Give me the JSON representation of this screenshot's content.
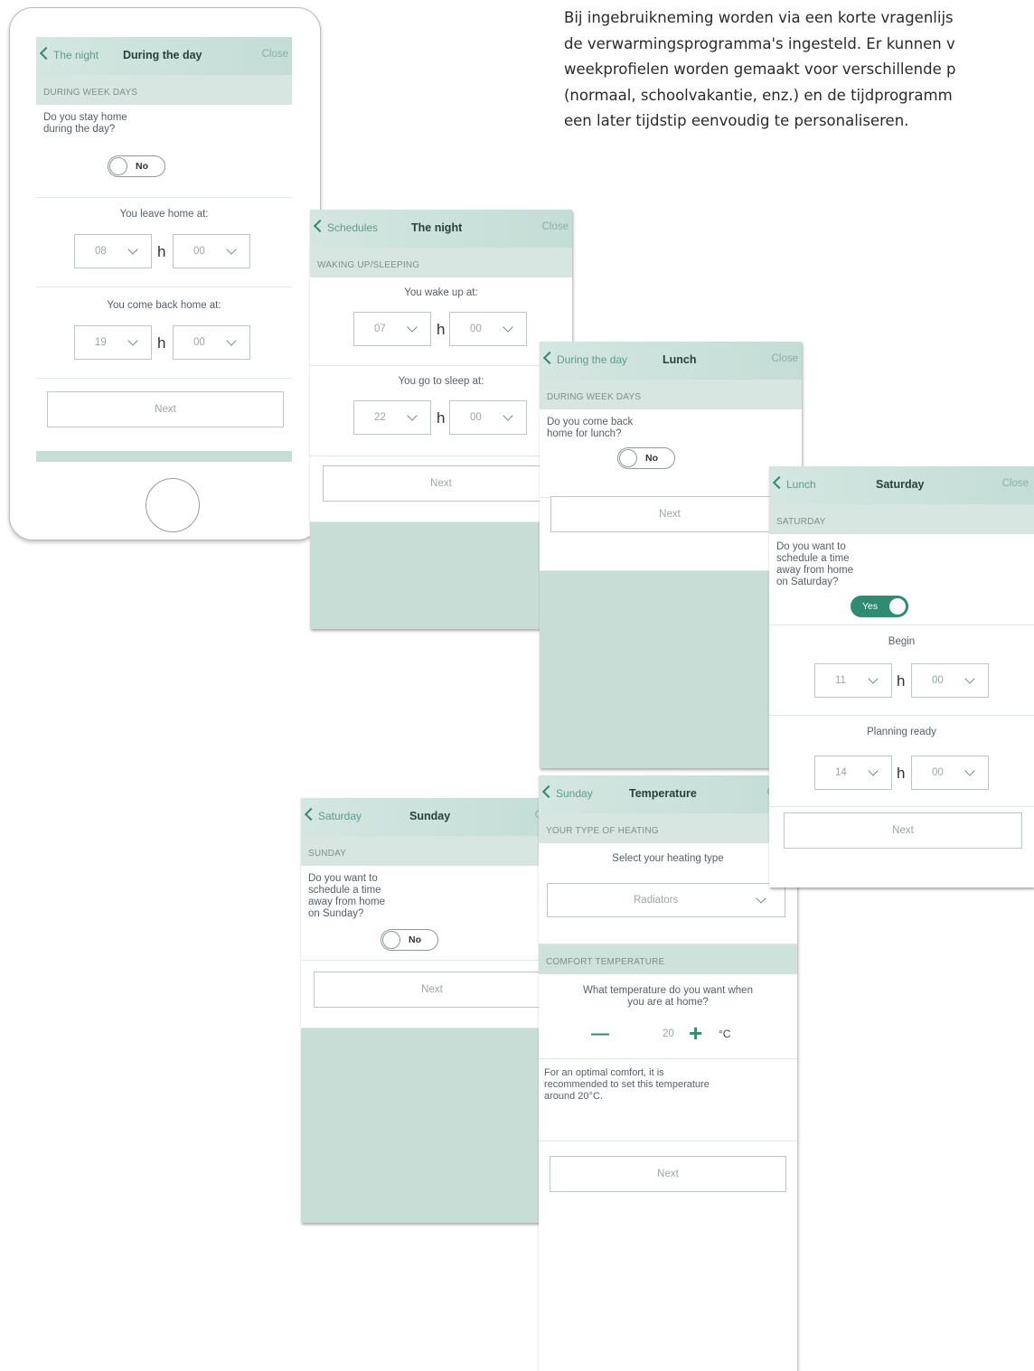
{
  "intro_lines": [
    "Bij ingebruikneming worden via een korte vragenlijs",
    "de verwarmingsprogramma's ingesteld. Er kunnen v",
    "weekprofielen worden gemaakt voor verschillende p",
    "(normaal, schoolvakantie, enz.) en de tijdprogramm",
    "een later tijdstip eenvoudig te personaliseren."
  ],
  "close_label": "Close",
  "next_label": "Next",
  "h_label": "h",
  "day": {
    "back": "The night",
    "title": "During the day",
    "section": "DURING WEEK DAYS",
    "question": [
      "Do you stay home",
      "during the day?"
    ],
    "toggle": "No",
    "leave_label": "You leave home at:",
    "leave_hour": "08",
    "leave_min": "00",
    "return_label": "You come back home at:",
    "return_hour": "19",
    "return_min": "00"
  },
  "night": {
    "back": "Schedules",
    "title": "The night",
    "section": "WAKING UP/SLEEPING",
    "wake_label": "You wake up at:",
    "wake_hour": "07",
    "wake_min": "00",
    "sleep_label": "You go to sleep at:",
    "sleep_hour": "22",
    "sleep_min": "00"
  },
  "lunch": {
    "back": "During the day",
    "title": "Lunch",
    "section": "DURING WEEK DAYS",
    "question": [
      "Do you come back",
      "home for lunch?"
    ],
    "toggle": "No"
  },
  "saturday": {
    "back": "Lunch",
    "title": "Saturday",
    "section": "SATURDAY",
    "question": [
      "Do you want to",
      "schedule a time",
      "away from home",
      "on Saturday?"
    ],
    "toggle": "Yes",
    "begin_label": "Begin",
    "begin_hour": "11",
    "begin_min": "00",
    "ready_label": "Planning ready",
    "ready_hour": "14",
    "ready_min": "00"
  },
  "sunday": {
    "back": "Saturday",
    "title": "Sunday",
    "section": "SUNDAY",
    "question": [
      "Do you want to",
      "schedule a time",
      "away from home",
      "on Sunday?"
    ],
    "toggle": "No"
  },
  "temperature": {
    "back": "Sunday",
    "title": "Temperature",
    "section1": "YOUR TYPE OF HEATING",
    "select_label": "Select your heating type",
    "heating_type": "Radiators",
    "section2": "COMFORT TEMPERATURE",
    "question": [
      "What temperature do you want when",
      "you are at home?"
    ],
    "minus": "—",
    "value": "20",
    "plus": "+",
    "unit": "°C",
    "note": [
      "For an optimal comfort, it is",
      "recommended to set this temperature",
      "around 20°C."
    ]
  },
  "colors": {
    "accent": "#2f8c72",
    "header": "#c4ddd6",
    "screen_bg": "#c7ddd5"
  }
}
